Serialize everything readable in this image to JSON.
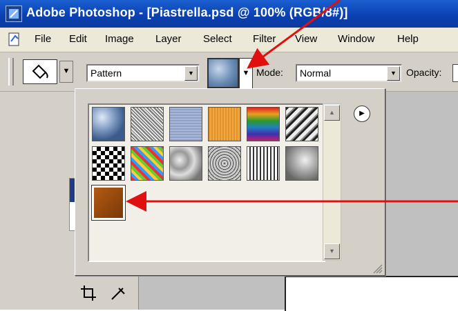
{
  "window": {
    "title": "Adobe Photoshop - [Piastrella.psd @ 100% (RGB/8#)]"
  },
  "menubar": {
    "items": [
      "File",
      "Edit",
      "Image",
      "Layer",
      "Select",
      "Filter",
      "View",
      "Window",
      "Help"
    ]
  },
  "options_bar": {
    "fill_source_value": "Pattern",
    "mode_label": "Mode:",
    "mode_value": "Normal",
    "opacity_label": "Opacity:"
  },
  "pattern_picker": {
    "patterns": [
      "bubbles",
      "wrinkles",
      "blue-cloth",
      "orange-fabric",
      "rainbow-stripes",
      "tie-dye",
      "checkerboard",
      "colorful-mosaic",
      "gray-stones",
      "gravel",
      "metal-chain",
      "gray-granite",
      "brown-tile"
    ],
    "selected_pattern": "brown-tile"
  },
  "annotations": {
    "arrow_color": "#e01010"
  },
  "colors": {
    "titlebar": "#0a3fb0",
    "chrome": "#d4d0c8"
  }
}
